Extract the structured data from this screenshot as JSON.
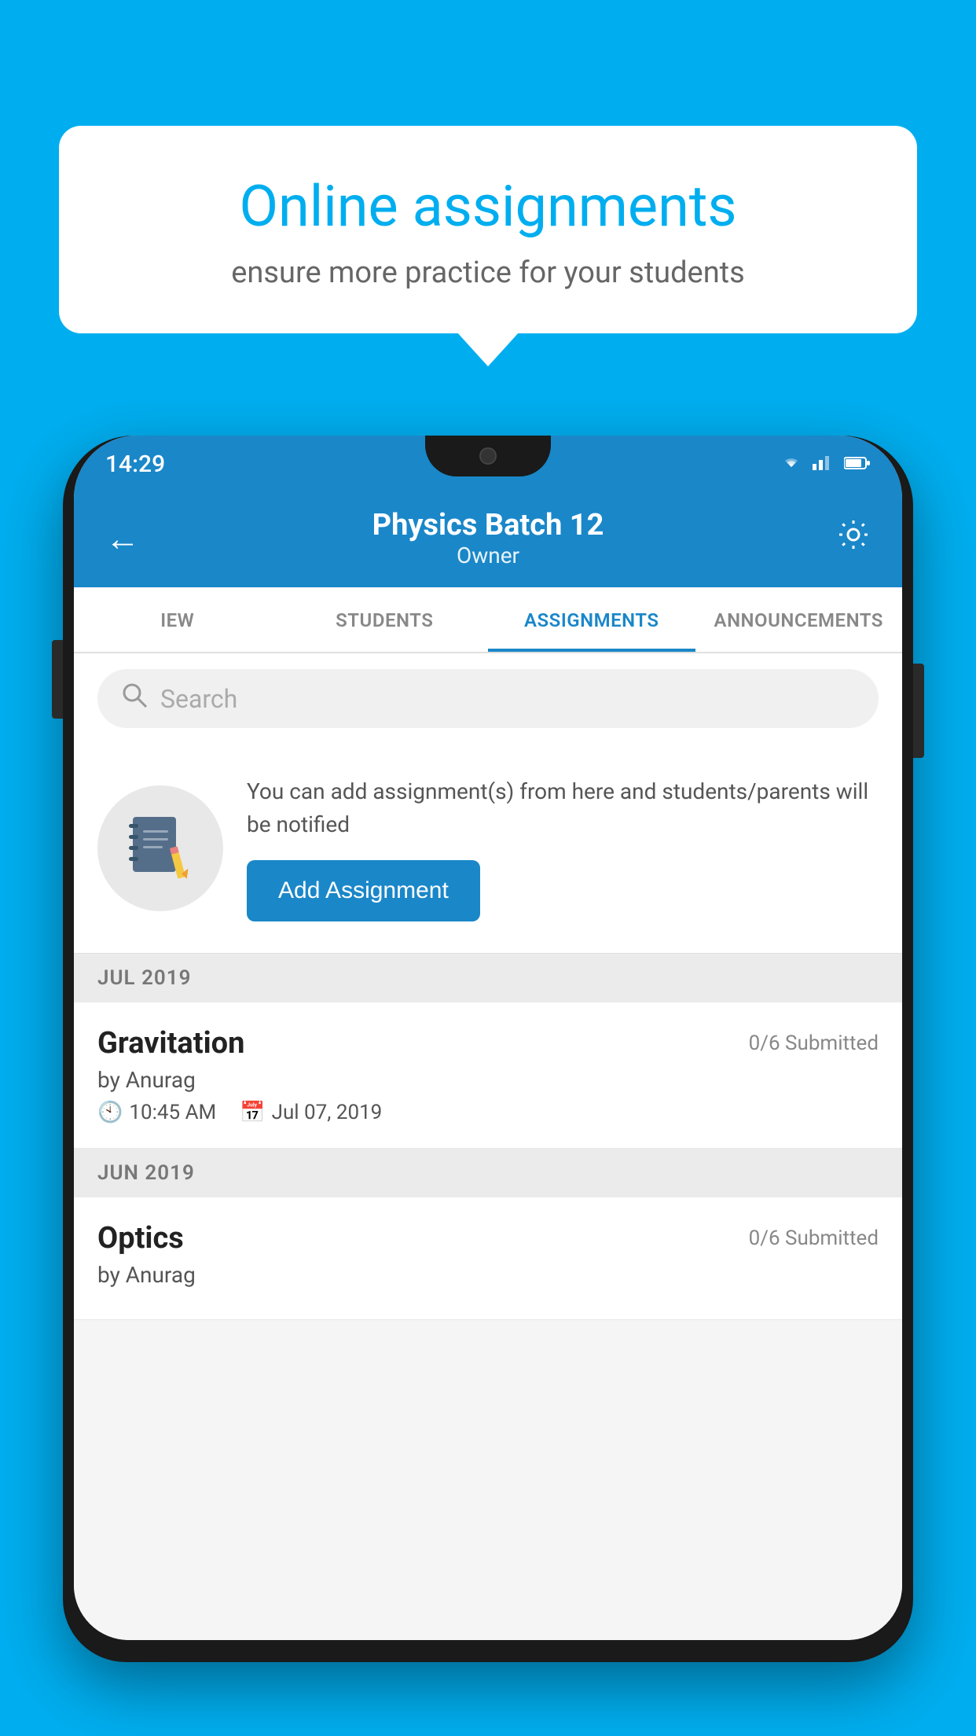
{
  "background_color": "#00AEEF",
  "speech_bubble": {
    "title": "Online assignments",
    "subtitle": "ensure more practice for your students"
  },
  "phone": {
    "status_bar": {
      "time": "14:29"
    },
    "header": {
      "title": "Physics Batch 12",
      "subtitle": "Owner",
      "back_label": "←",
      "settings_label": "⚙"
    },
    "tabs": [
      {
        "label": "IEW",
        "active": false
      },
      {
        "label": "STUDENTS",
        "active": false
      },
      {
        "label": "ASSIGNMENTS",
        "active": true
      },
      {
        "label": "ANNOUNCEMENTS",
        "active": false
      }
    ],
    "search": {
      "placeholder": "Search"
    },
    "promo": {
      "text": "You can add assignment(s) from here and students/parents will be notified",
      "button_label": "Add Assignment"
    },
    "sections": [
      {
        "label": "JUL 2019",
        "assignments": [
          {
            "name": "Gravitation",
            "submitted": "0/6 Submitted",
            "by": "by Anurag",
            "time": "10:45 AM",
            "date": "Jul 07, 2019"
          }
        ]
      },
      {
        "label": "JUN 2019",
        "assignments": [
          {
            "name": "Optics",
            "submitted": "0/6 Submitted",
            "by": "by Anurag",
            "time": "",
            "date": ""
          }
        ]
      }
    ]
  }
}
